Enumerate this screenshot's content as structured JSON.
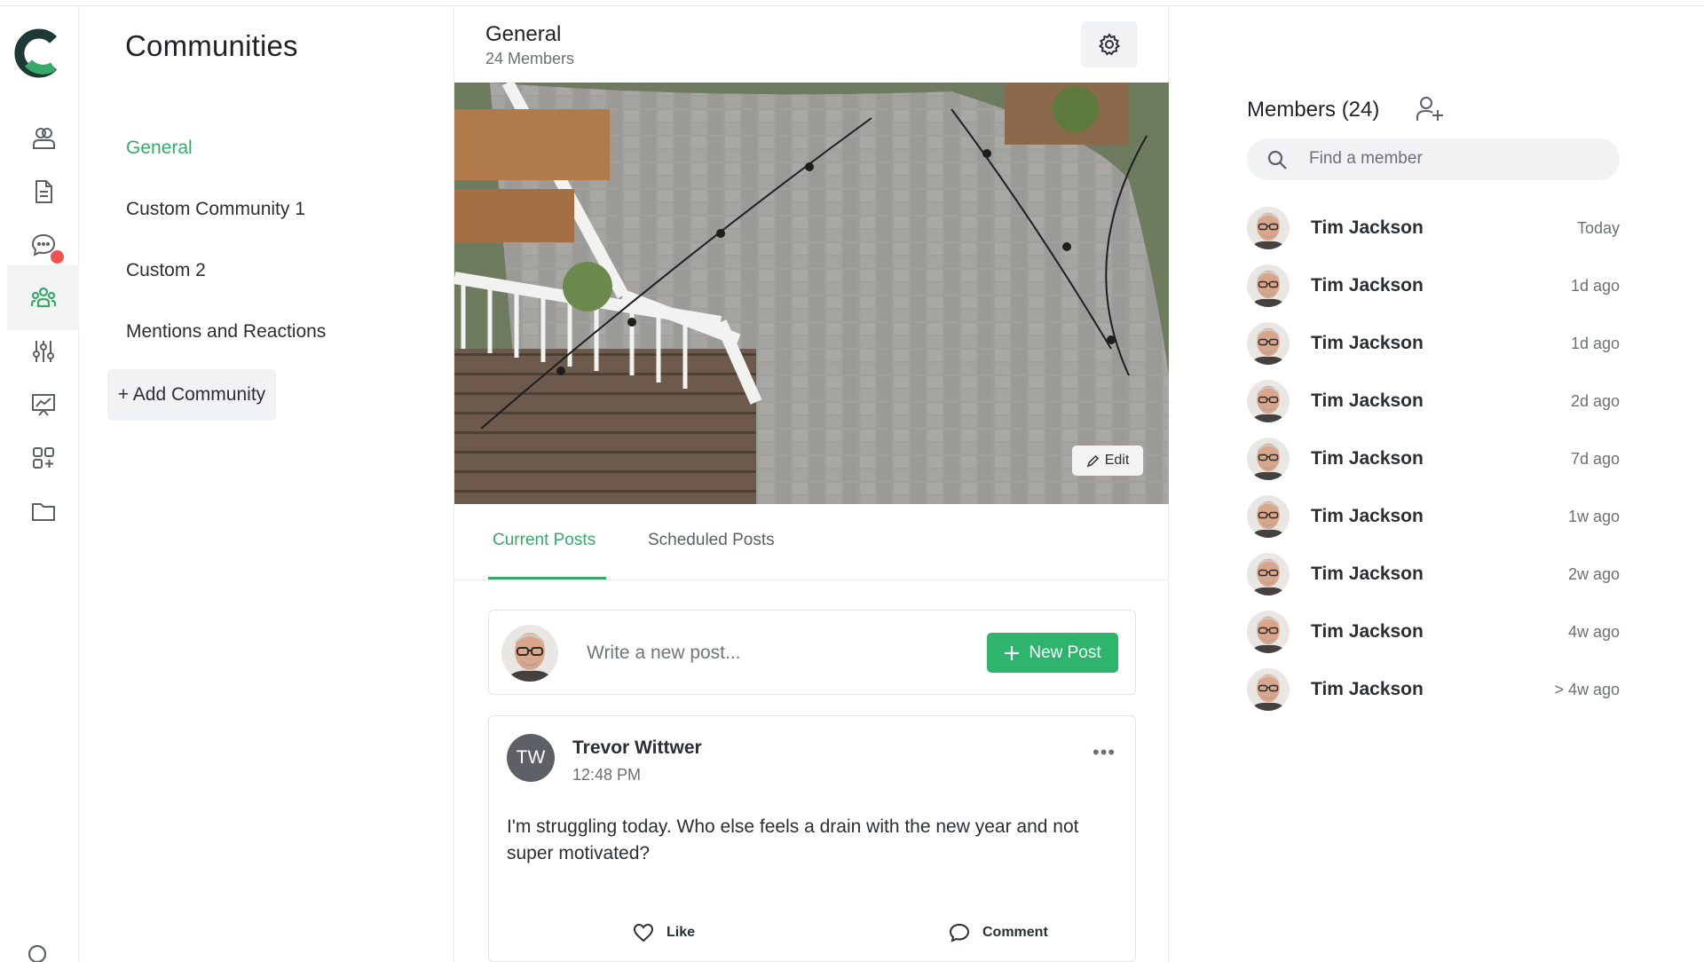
{
  "communities_panel": {
    "title": "Communities",
    "items": [
      {
        "label": "General",
        "active": true
      },
      {
        "label": "Custom Community 1",
        "active": false
      },
      {
        "label": "Custom 2",
        "active": false
      },
      {
        "label": "Mentions and Reactions",
        "active": false
      }
    ],
    "add_label": "+ Add Community"
  },
  "rail": {
    "icons": [
      "contacts-icon",
      "document-icon",
      "chat-icon",
      "community-icon",
      "sliders-icon",
      "presentation-chart-icon",
      "apps-add-icon",
      "folder-icon",
      "search-icon"
    ],
    "active": "community-icon",
    "badge_color": "#ef5350"
  },
  "main": {
    "title": "General",
    "subtitle": "24 Members",
    "edit_label": "Edit",
    "tabs": [
      {
        "label": "Current Posts",
        "active": true
      },
      {
        "label": "Scheduled Posts",
        "active": false
      }
    ],
    "composer": {
      "placeholder": "Write a new post...",
      "button_label": "New Post"
    },
    "post": {
      "initials": "TW",
      "author": "Trevor Wittwer",
      "time": "12:48 PM",
      "body": "I'm struggling today. Who else feels a drain with the new year and not super motivated?",
      "like_label": "Like",
      "comment_label": "Comment"
    }
  },
  "members": {
    "title": "Members (24)",
    "search_placeholder": "Find a member",
    "list": [
      {
        "name": "Tim Jackson",
        "time": "Today"
      },
      {
        "name": "Tim Jackson",
        "time": "1d ago"
      },
      {
        "name": "Tim Jackson",
        "time": "1d ago"
      },
      {
        "name": "Tim Jackson",
        "time": "2d ago"
      },
      {
        "name": "Tim Jackson",
        "time": "7d ago"
      },
      {
        "name": "Tim Jackson",
        "time": "1w ago"
      },
      {
        "name": "Tim Jackson",
        "time": "2w ago"
      },
      {
        "name": "Tim Jackson",
        "time": "4w ago"
      },
      {
        "name": "Tim Jackson",
        "time": "> 4w ago"
      }
    ]
  },
  "colors": {
    "accent": "#3aa86b",
    "button_green": "#2fb46e",
    "logo_dark": "#1f3a36",
    "avatar_initials_bg": "#5d6067"
  }
}
